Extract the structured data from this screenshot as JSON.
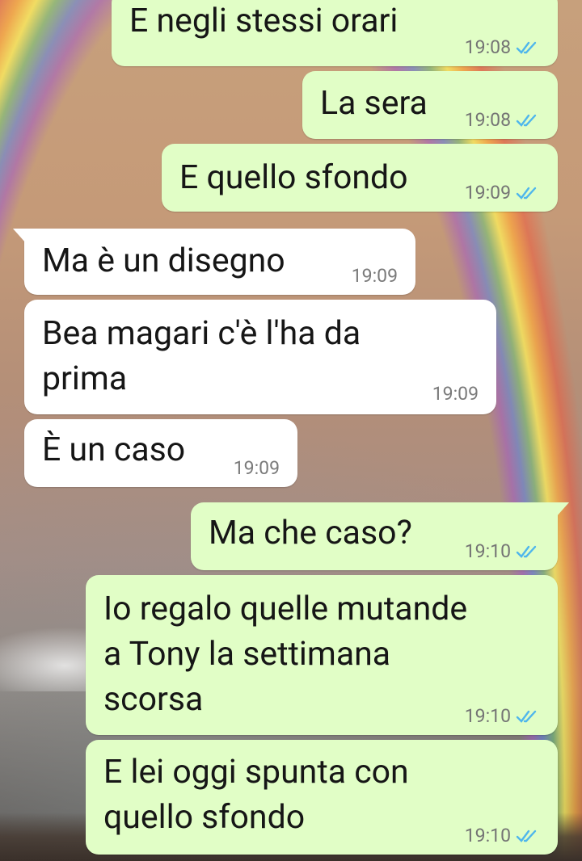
{
  "messages": [
    {
      "direction": "out",
      "text": "E negli stessi orari",
      "time": "19:08",
      "status_icon": "double-check-read-icon"
    },
    {
      "direction": "out",
      "text": "La sera",
      "time": "19:08",
      "status_icon": "double-check-read-icon"
    },
    {
      "direction": "out",
      "text": "E quello sfondo",
      "time": "19:09",
      "status_icon": "double-check-read-icon"
    },
    {
      "direction": "in",
      "text": "Ma è un disegno",
      "time": "19:09"
    },
    {
      "direction": "in",
      "text": "Bea magari c'è l'ha da\nprima",
      "time": "19:09"
    },
    {
      "direction": "in",
      "text": "È un caso",
      "time": "19:09"
    },
    {
      "direction": "out",
      "text": "Ma che caso?",
      "time": "19:10",
      "status_icon": "double-check-read-icon"
    },
    {
      "direction": "out",
      "text": "Io regalo quelle mutande\na Tony la settimana\nscorsa",
      "time": "19:10",
      "status_icon": "double-check-read-icon"
    },
    {
      "direction": "out",
      "text": "E lei oggi spunta con\nquello sfondo",
      "time": "19:10",
      "status_icon": "double-check-read-icon"
    }
  ],
  "colors": {
    "outgoing_bubble": "#e1fec6",
    "incoming_bubble": "#ffffff",
    "read_ticks": "#4fb6ec",
    "time_text": "#747474"
  },
  "wallpaper": "rainbow-sunset-image"
}
